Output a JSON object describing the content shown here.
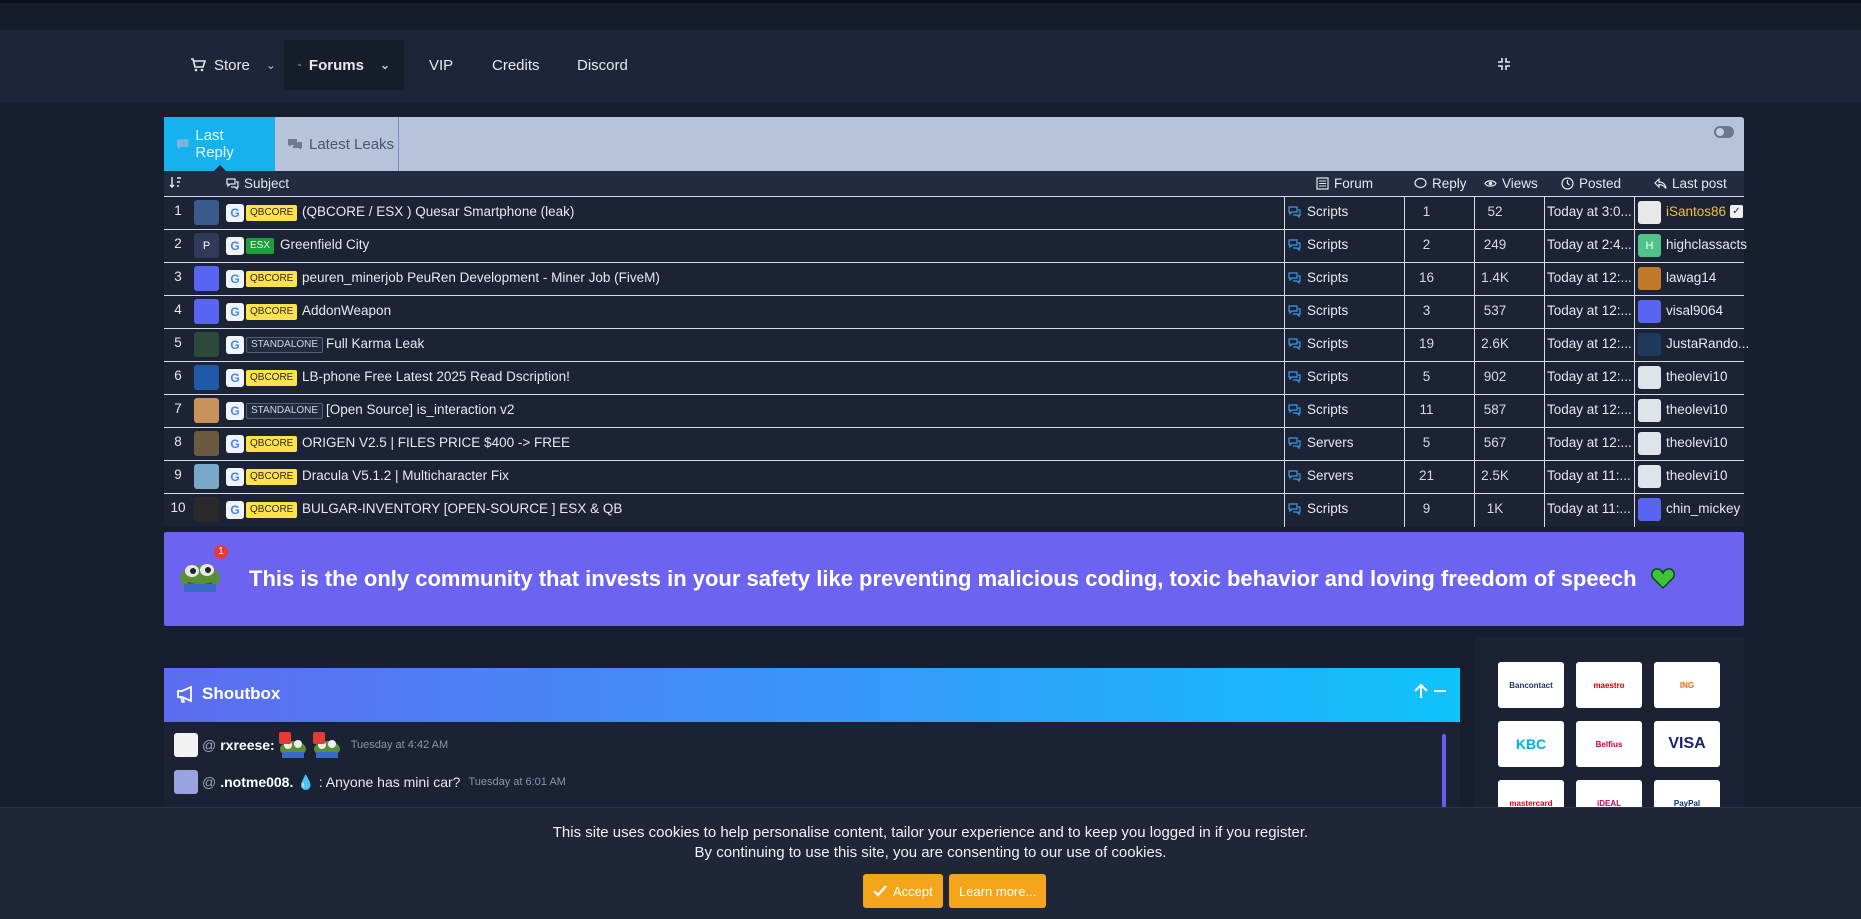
{
  "nav": {
    "items": [
      {
        "label": "Store",
        "icon": "cart-icon",
        "dropdown": true
      },
      {
        "label": "Forums",
        "icon": "comments-icon",
        "dropdown": true,
        "active": true
      },
      {
        "label": "VIP"
      },
      {
        "label": "Credits"
      },
      {
        "label": "Discord"
      }
    ]
  },
  "widget": {
    "tabs": [
      {
        "label": "Last Reply",
        "icon": "comment-icon",
        "active": true
      },
      {
        "label": "Latest Leaks",
        "icon": "comments-icon"
      }
    ],
    "columns": {
      "subject": "Subject",
      "forum": "Forum",
      "reply": "Reply",
      "views": "Views",
      "posted": "Posted",
      "last_post": "Last post"
    },
    "rows": [
      {
        "num": "1",
        "prefix": "QBCORE",
        "subject": "(QBCORE / ESX ) Quesar Smartphone (leak)",
        "forum": "Scripts",
        "replies": "1",
        "views": "52",
        "posted": "Today at 3:0...",
        "last_user": "iSantos86",
        "avatar_color": "#3a5a8c",
        "lp_color": "#e8e8e8"
      },
      {
        "num": "2",
        "prefix": "ESX",
        "subject": "Greenfield City",
        "forum": "Scripts",
        "replies": "2",
        "views": "249",
        "posted": "Today at 2:4...",
        "last_user": "highclassacts",
        "avatar_color": "#313a59",
        "avatar_letter": "P",
        "lp_color": "#4fc38a",
        "lp_letter": "H"
      },
      {
        "num": "3",
        "prefix": "QBCORE",
        "subject": "peuren_minerjob PeuRen Development - Miner Job (FiveM)",
        "forum": "Scripts",
        "replies": "16",
        "views": "1.4K",
        "posted": "Today at 12:...",
        "last_user": "lawag14",
        "avatar_color": "#5865f2",
        "lp_color": "#c07a2a"
      },
      {
        "num": "4",
        "prefix": "QBCORE",
        "subject": "AddonWeapon",
        "forum": "Scripts",
        "replies": "3",
        "views": "537",
        "posted": "Today at 12:...",
        "last_user": "visal9064",
        "avatar_color": "#5865f2",
        "lp_color": "#5865f2"
      },
      {
        "num": "5",
        "prefix": "STANDALONE",
        "subject": "Full Karma Leak",
        "forum": "Scripts",
        "replies": "19",
        "views": "2.6K",
        "posted": "Today at 12:...",
        "last_user": "JustaRando...",
        "avatar_color": "#2c4a3a",
        "lp_color": "#1d3a5a"
      },
      {
        "num": "6",
        "prefix": "QBCORE",
        "subject": "LB-phone Free Latest 2025 Read Dscription!",
        "forum": "Scripts",
        "replies": "5",
        "views": "902",
        "posted": "Today at 12:...",
        "last_user": "theolevi10",
        "avatar_color": "#1f5aa8",
        "lp_color": "#dfe3ea"
      },
      {
        "num": "7",
        "prefix": "STANDALONE",
        "subject": "[Open Source] is_interaction v2",
        "forum": "Scripts",
        "replies": "11",
        "views": "587",
        "posted": "Today at 12:...",
        "last_user": "theolevi10",
        "avatar_color": "#c9925a",
        "lp_color": "#dfe3ea"
      },
      {
        "num": "8",
        "prefix": "QBCORE",
        "subject": "ORIGEN V2.5 | FILES PRICE $400 -> FREE",
        "forum": "Servers",
        "replies": "5",
        "views": "567",
        "posted": "Today at 12:...",
        "last_user": "theolevi10",
        "avatar_color": "#6a5a40",
        "lp_color": "#dfe3ea"
      },
      {
        "num": "9",
        "prefix": "QBCORE",
        "subject": "Dracula V5.1.2 | Multicharacter Fix",
        "forum": "Servers",
        "replies": "21",
        "views": "2.5K",
        "posted": "Today at 11:...",
        "last_user": "theolevi10",
        "avatar_color": "#7aa8c8",
        "lp_color": "#dfe3ea"
      },
      {
        "num": "10",
        "prefix": "QBCORE",
        "subject": "BULGAR-INVENTORY [OPEN-SOURCE ] ESX & QB",
        "forum": "Scripts",
        "replies": "9",
        "views": "1K",
        "posted": "Today at 11:...",
        "last_user": "chin_mickey",
        "avatar_color": "#2a2a2a",
        "lp_color": "#5865f2"
      }
    ]
  },
  "banner": {
    "text": "This is the only community that invests in your safety like preventing malicious coding, toxic behavior and loving freedom of speech",
    "notification_count": "1"
  },
  "shoutbox": {
    "title": "Shoutbox",
    "messages": [
      {
        "at": "@",
        "user": "rxreese:",
        "text": "",
        "time": "Tuesday at 4:42 AM"
      },
      {
        "at": "@",
        "user": ".notme008.",
        "text": ": Anyone has mini car?",
        "time": "Tuesday at 6:01 AM"
      }
    ],
    "emote_badge": "1"
  },
  "payments": [
    "Bancontact",
    "maestro",
    "ING",
    "KBC",
    "Belfius",
    "VISA",
    "mastercard",
    "iDEAL",
    "PayPal"
  ],
  "cookie": {
    "line1": "This site uses cookies to help personalise content, tailor your experience and to keep you logged in if you register.",
    "line2": "By continuing to use this site, you are consenting to our use of cookies.",
    "accept": "Accept",
    "learn_more": "Learn more..."
  },
  "colors": {
    "accent": "#17b1f0",
    "banner": "#6c63f1",
    "button": "#f4a51c",
    "badge_qbcore": "#ffe14a",
    "badge_esx": "#1f9e3a"
  }
}
